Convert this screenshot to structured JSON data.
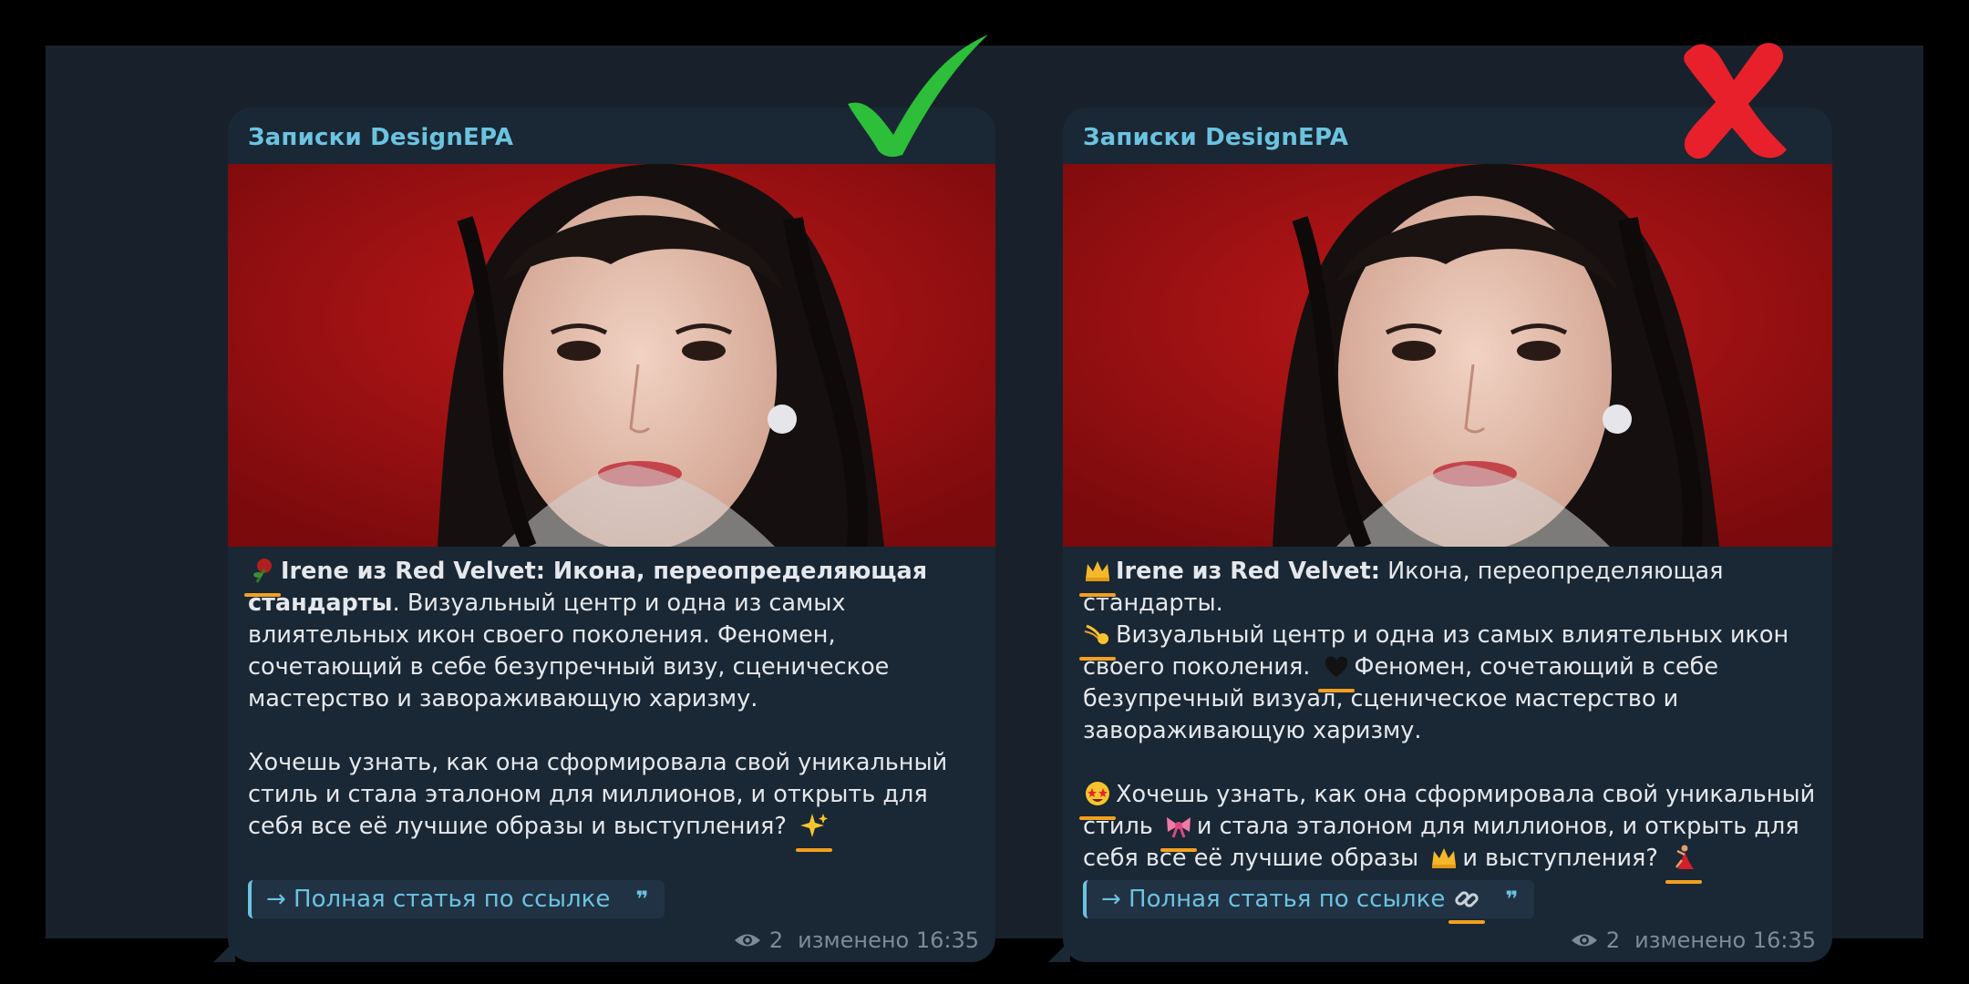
{
  "colors": {
    "background": "#000000",
    "frame": "#18212b",
    "bubble": "#1a2734",
    "accent": "#6bc3e0",
    "text": "#e4e8ec",
    "meta": "#7d8b99",
    "underline": "#f2a020",
    "check": "#2dbe3a",
    "cross": "#e8202b"
  },
  "posts": [
    {
      "verdict_icon": "check-icon",
      "channel": "Записки DesignEPA",
      "title": "Irene из Red Velvet: Икона, переопределяющая стандарты",
      "para1_rest": ". Визуальный центр и одна из самых влиятельных икон своего поколения. Феномен, сочетающий в себе безупречный визу, сценическое мастерство и завораживающую харизму.",
      "para2": "Хочешь узнать, как она сформировала свой уникальный стиль и стала эталоном для миллионов, и открыть для себя все её лучшие образы и выступления?",
      "link": "→ Полная статья по ссылке",
      "quote": "❞",
      "views": "2",
      "edited": "изменено 16:35",
      "emojis": [
        "rose-emoji",
        "sparkles-emoji"
      ]
    },
    {
      "verdict_icon": "cross-icon",
      "channel": "Записки DesignEPA",
      "title": "Irene из Red Velvet:",
      "line1_rest": " Икона, переопределяющая стандарты.",
      "line2": "Визуальный центр и одна из самых влиятельных икон своего поколения.",
      "line3": "Феномен, сочетающий в себе безупречный визуал, сценическое мастерство и завораживающую харизму.",
      "p2_a": "Хочешь узнать, как она сформировала свой уникальный стиль",
      "p2_b": "и стала эталоном для миллионов, и открыть для себя все её лучшие образы",
      "p2_c": "и выступления?",
      "link": "→ Полная статья по ссылке",
      "quote": "❞",
      "views": "2",
      "edited": "изменено 16:35",
      "emojis": [
        "crown-emoji",
        "comet-emoji",
        "black-heart-emoji",
        "star-struck-emoji",
        "ribbon-emoji",
        "crown-emoji",
        "dancer-emoji",
        "link-emoji"
      ]
    }
  ]
}
